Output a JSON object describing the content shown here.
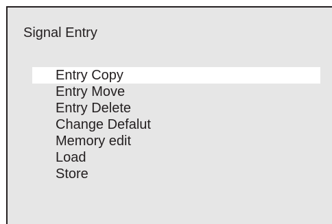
{
  "screen": {
    "title": "Signal Entry",
    "selected_index": 0,
    "menu_items": [
      {
        "label": "Entry Copy"
      },
      {
        "label": "Entry Move"
      },
      {
        "label": "Entry Delete"
      },
      {
        "label": "Change Defalut"
      },
      {
        "label": "Memory edit"
      },
      {
        "label": "Load"
      },
      {
        "label": "Store"
      }
    ]
  },
  "colors": {
    "panel_background": "#e6e6e6",
    "highlight": "#ffffff",
    "text": "#231f20",
    "border": "#231f20"
  }
}
